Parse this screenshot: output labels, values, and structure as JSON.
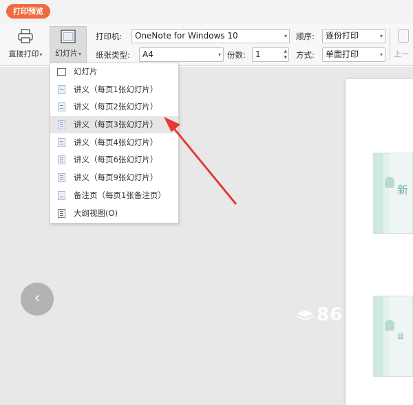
{
  "tab": {
    "label": "打印预览"
  },
  "toolbar": {
    "direct_print": {
      "label": "直接打印",
      "icon": "printer-icon"
    },
    "slides": {
      "label": "幻灯片",
      "icon": "slide-layout-icon"
    },
    "printer": {
      "label": "打印机:",
      "value": "OneNote for Windows 10"
    },
    "paper": {
      "label": "纸张类型:",
      "value": "A4"
    },
    "copies": {
      "label": "份数:",
      "value": "1"
    },
    "order": {
      "label": "顺序:",
      "value": "逐份打印"
    },
    "mode": {
      "label": "方式:",
      "value": "单面打印"
    },
    "prev_page": {
      "label": "上一"
    }
  },
  "dropdown": {
    "items": [
      {
        "label": "幻灯片",
        "icon": "slide-icon"
      },
      {
        "label": "讲义（每页1张幻灯片）",
        "icon": "handout-1-icon"
      },
      {
        "label": "讲义（每页2张幻灯片）",
        "icon": "handout-2-icon"
      },
      {
        "label": "讲义（每页3张幻灯片）",
        "icon": "handout-3-icon",
        "highlighted": true
      },
      {
        "label": "讲义（每页4张幻灯片）",
        "icon": "handout-4-icon"
      },
      {
        "label": "讲义（每页6张幻灯片）",
        "icon": "handout-6-icon"
      },
      {
        "label": "讲义（每页9张幻灯片）",
        "icon": "handout-9-icon"
      },
      {
        "label": "备注页（每页1张备注页）",
        "icon": "notes-page-icon"
      },
      {
        "label": "大纲视图(O)",
        "icon": "outline-view-icon"
      }
    ]
  },
  "preview": {
    "thumb1_text": "新",
    "thumb2_text": "目"
  },
  "watermark": {
    "text": "86"
  },
  "colors": {
    "tab": "#f0693f",
    "annotation_arrow": "#e53935",
    "highlight": "#e6e6e6"
  }
}
